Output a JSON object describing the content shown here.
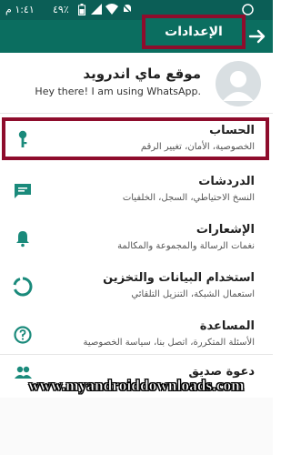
{
  "colors": {
    "status_bar": "#0b5e56",
    "app_bar": "#0b6e60",
    "accent_icon": "#1a8a7b",
    "highlight_border": "#8e0c2c"
  },
  "status_bar": {
    "time": "١:٤١ م",
    "battery": "٤٩٪"
  },
  "header": {
    "title": "الإعدادات",
    "back_icon": "arrow-right-icon"
  },
  "profile": {
    "name": "موقع ماي اندرويد",
    "status": "Hey there! I am using WhatsApp."
  },
  "settings": [
    {
      "title": "الحساب",
      "subtitle": "الخصوصية، الأمان، تغيير الرقم",
      "icon": "key-icon"
    },
    {
      "title": "الدردشات",
      "subtitle": "النسخ الاحتياطي، السجل، الخلفيات",
      "icon": "chat-icon"
    },
    {
      "title": "الإشعارات",
      "subtitle": "نغمات الرسالة والمجموعة والمكالمة",
      "icon": "bell-icon"
    },
    {
      "title": "استخدام البيانات والتخزين",
      "subtitle": "استعمال الشبكة، التنزيل التلقائي",
      "icon": "data-usage-icon"
    },
    {
      "title": "المساعدة",
      "subtitle": "الأسئلة المتكررة، اتصل بنا، سياسة الخصوصية",
      "icon": "help-icon"
    },
    {
      "title": "دعوة صديق",
      "subtitle": "",
      "icon": "people-icon"
    }
  ],
  "watermark": "www.myandroiddownloads.com"
}
